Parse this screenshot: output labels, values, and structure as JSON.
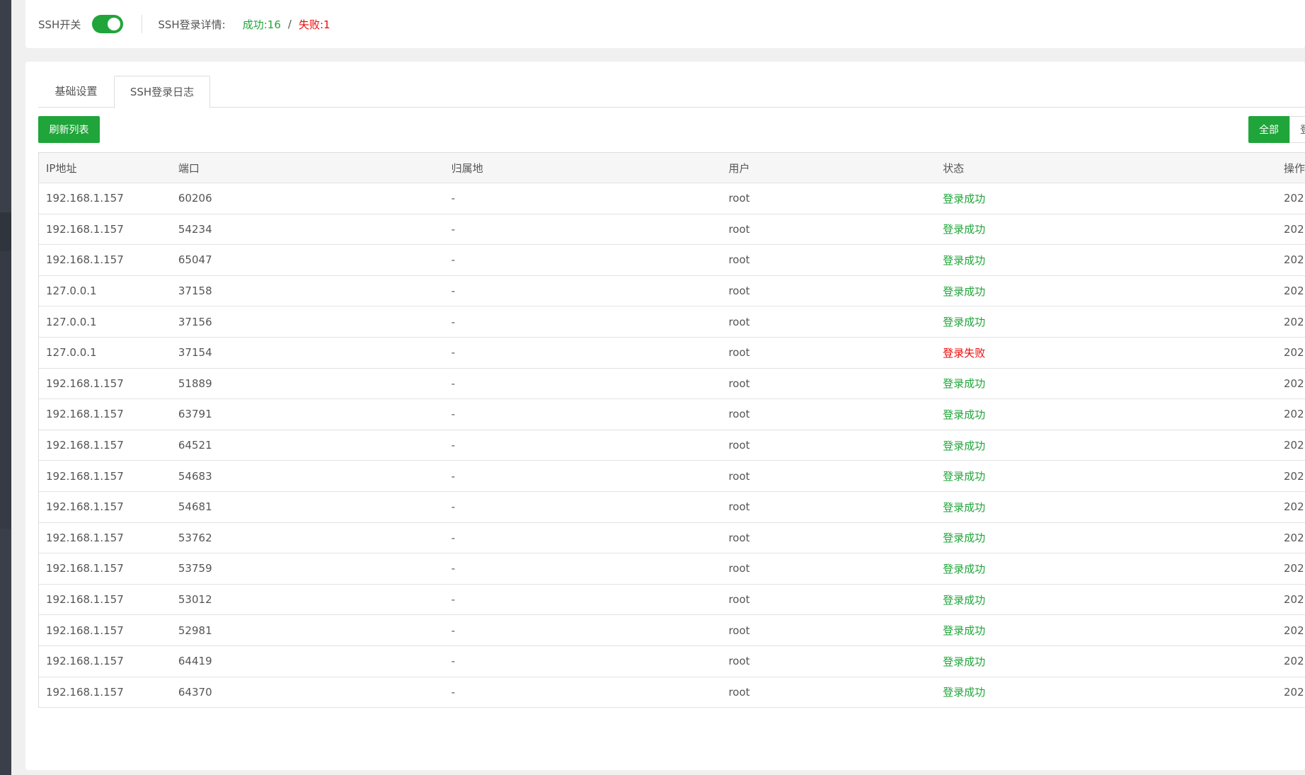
{
  "top": {
    "ssh_switch_label": "SSH开关",
    "ssh_switch_on": true,
    "details_label": "SSH登录详情:",
    "success_label": "成功:",
    "success_count": "16",
    "separator": "/",
    "fail_label": "失败:",
    "fail_count": "1"
  },
  "tabs": [
    {
      "label": "基础设置",
      "active": false
    },
    {
      "label": "SSH登录日志",
      "active": true
    }
  ],
  "toolbar": {
    "refresh_label": "刷新列表",
    "filters": [
      {
        "label": "全部",
        "active": true
      },
      {
        "label": "登",
        "active": false
      }
    ]
  },
  "table": {
    "headers": [
      "IP地址",
      "端口",
      "归属地",
      "用户",
      "状态",
      "操作"
    ],
    "rows": [
      {
        "ip": "192.168.1.157",
        "port": "60206",
        "loc": "-",
        "user": "root",
        "status": "登录成功",
        "ok": true,
        "time": "202"
      },
      {
        "ip": "192.168.1.157",
        "port": "54234",
        "loc": "-",
        "user": "root",
        "status": "登录成功",
        "ok": true,
        "time": "202"
      },
      {
        "ip": "192.168.1.157",
        "port": "65047",
        "loc": "-",
        "user": "root",
        "status": "登录成功",
        "ok": true,
        "time": "202"
      },
      {
        "ip": "127.0.0.1",
        "port": "37158",
        "loc": "-",
        "user": "root",
        "status": "登录成功",
        "ok": true,
        "time": "202"
      },
      {
        "ip": "127.0.0.1",
        "port": "37156",
        "loc": "-",
        "user": "root",
        "status": "登录成功",
        "ok": true,
        "time": "202"
      },
      {
        "ip": "127.0.0.1",
        "port": "37154",
        "loc": "-",
        "user": "root",
        "status": "登录失败",
        "ok": false,
        "time": "202"
      },
      {
        "ip": "192.168.1.157",
        "port": "51889",
        "loc": "-",
        "user": "root",
        "status": "登录成功",
        "ok": true,
        "time": "202"
      },
      {
        "ip": "192.168.1.157",
        "port": "63791",
        "loc": "-",
        "user": "root",
        "status": "登录成功",
        "ok": true,
        "time": "202"
      },
      {
        "ip": "192.168.1.157",
        "port": "64521",
        "loc": "-",
        "user": "root",
        "status": "登录成功",
        "ok": true,
        "time": "202"
      },
      {
        "ip": "192.168.1.157",
        "port": "54683",
        "loc": "-",
        "user": "root",
        "status": "登录成功",
        "ok": true,
        "time": "202"
      },
      {
        "ip": "192.168.1.157",
        "port": "54681",
        "loc": "-",
        "user": "root",
        "status": "登录成功",
        "ok": true,
        "time": "202"
      },
      {
        "ip": "192.168.1.157",
        "port": "53762",
        "loc": "-",
        "user": "root",
        "status": "登录成功",
        "ok": true,
        "time": "202"
      },
      {
        "ip": "192.168.1.157",
        "port": "53759",
        "loc": "-",
        "user": "root",
        "status": "登录成功",
        "ok": true,
        "time": "202"
      },
      {
        "ip": "192.168.1.157",
        "port": "53012",
        "loc": "-",
        "user": "root",
        "status": "登录成功",
        "ok": true,
        "time": "202"
      },
      {
        "ip": "192.168.1.157",
        "port": "52981",
        "loc": "-",
        "user": "root",
        "status": "登录成功",
        "ok": true,
        "time": "202"
      },
      {
        "ip": "192.168.1.157",
        "port": "64419",
        "loc": "-",
        "user": "root",
        "status": "登录成功",
        "ok": true,
        "time": "202"
      },
      {
        "ip": "192.168.1.157",
        "port": "64370",
        "loc": "-",
        "user": "root",
        "status": "登录成功",
        "ok": true,
        "time": "202"
      }
    ]
  },
  "colors": {
    "accent": "#20a53a",
    "fail": "#ef0808",
    "sidebar": "#3a3f4a"
  }
}
